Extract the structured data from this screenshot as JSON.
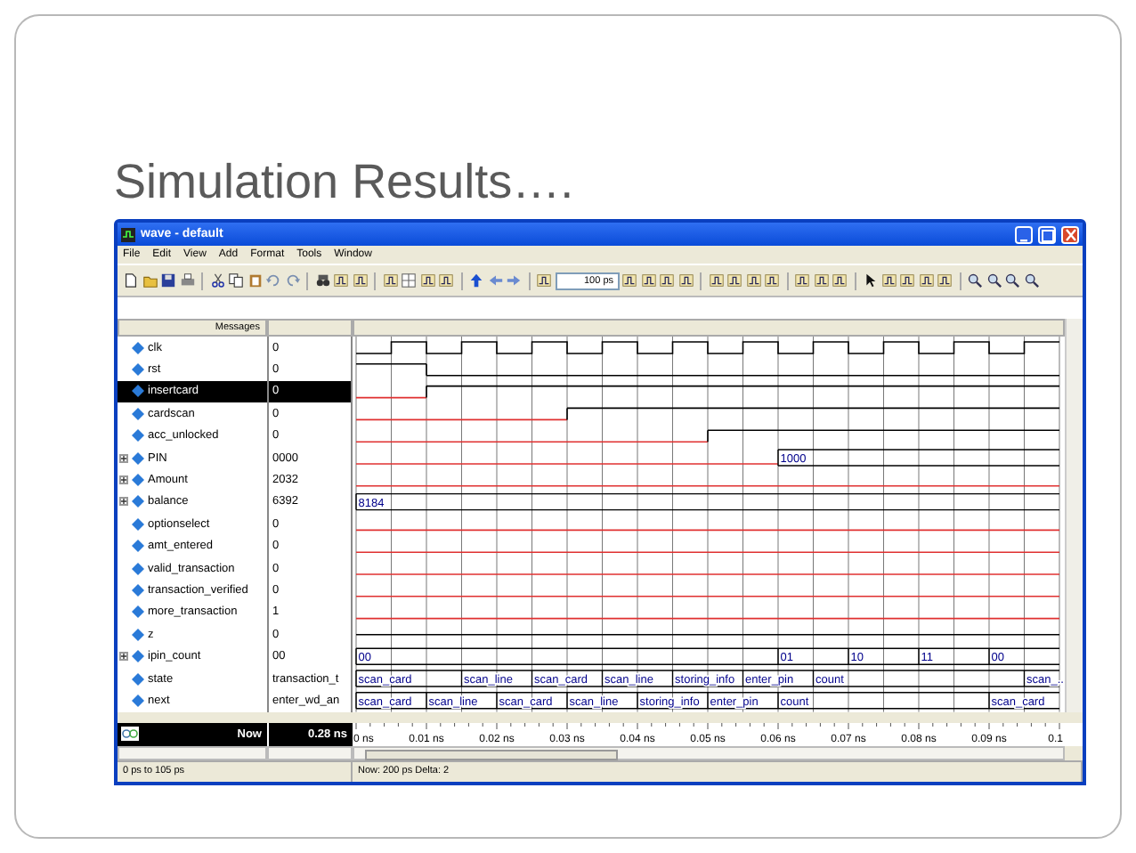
{
  "slide": {
    "title": "Simulation Results…."
  },
  "window": {
    "title": "wave - default"
  },
  "menu": [
    "File",
    "Edit",
    "View",
    "Add",
    "Format",
    "Tools",
    "Window"
  ],
  "toolbar": {
    "time_field": "100 ps"
  },
  "panel": {
    "header": "Messages"
  },
  "signals": [
    {
      "name": "clk",
      "value": "0",
      "kind": "clock",
      "expandable": false,
      "selected": false
    },
    {
      "name": "rst",
      "value": "0",
      "kind": "bit",
      "expandable": false,
      "selected": false
    },
    {
      "name": "insertcard",
      "value": "0",
      "kind": "bit",
      "expandable": false,
      "selected": true
    },
    {
      "name": "cardscan",
      "value": "0",
      "kind": "bit",
      "expandable": false,
      "selected": false
    },
    {
      "name": "acc_unlocked",
      "value": "0",
      "kind": "bit",
      "expandable": false,
      "selected": false
    },
    {
      "name": "PIN",
      "value": "0000",
      "kind": "bus",
      "expandable": true,
      "selected": false,
      "wave_labels": [
        "1000"
      ]
    },
    {
      "name": "Amount",
      "value": "2032",
      "kind": "bus",
      "expandable": true,
      "selected": false
    },
    {
      "name": "balance",
      "value": "6392",
      "kind": "bus",
      "expandable": true,
      "selected": false,
      "wave_labels": [
        "8184"
      ]
    },
    {
      "name": "optionselect",
      "value": "0",
      "kind": "bit",
      "expandable": false,
      "selected": false
    },
    {
      "name": "amt_entered",
      "value": "0",
      "kind": "bit",
      "expandable": false,
      "selected": false
    },
    {
      "name": "valid_transaction",
      "value": "0",
      "kind": "bit",
      "expandable": false,
      "selected": false
    },
    {
      "name": "transaction_verified",
      "value": "0",
      "kind": "bit",
      "expandable": false,
      "selected": false
    },
    {
      "name": "more_transaction",
      "value": "1",
      "kind": "bit",
      "expandable": false,
      "selected": false
    },
    {
      "name": "z",
      "value": "0",
      "kind": "bit",
      "expandable": false,
      "selected": false
    },
    {
      "name": "ipin_count",
      "value": "00",
      "kind": "bus",
      "expandable": true,
      "selected": false,
      "wave_labels": [
        "00",
        "01",
        "10",
        "11",
        "00"
      ]
    },
    {
      "name": "state",
      "value": "transaction_t",
      "kind": "bus",
      "expandable": false,
      "selected": false,
      "wave_labels": [
        "scan_card",
        "scan_line",
        "scan_card",
        "scan_line",
        "storing_info",
        "enter_pin",
        "count",
        "scan_..."
      ]
    },
    {
      "name": "next",
      "value": "enter_wd_an",
      "kind": "bus",
      "expandable": false,
      "selected": false,
      "wave_labels": [
        "scan_card",
        "scan_line",
        "scan_card",
        "scan_line",
        "storing_info",
        "enter_pin",
        "count",
        "scan_card"
      ]
    }
  ],
  "cursor": {
    "label": "Now",
    "time": "0.28 ns"
  },
  "time_axis": [
    "0 ns",
    "0.01 ns",
    "0.02 ns",
    "0.03 ns",
    "0.04 ns",
    "0.05 ns",
    "0.06 ns",
    "0.07 ns",
    "0.08 ns",
    "0.09 ns",
    "0.1"
  ],
  "status_bar": [
    "0 ps to 105 ps",
    "Now: 200 ps  Delta: 2"
  ]
}
